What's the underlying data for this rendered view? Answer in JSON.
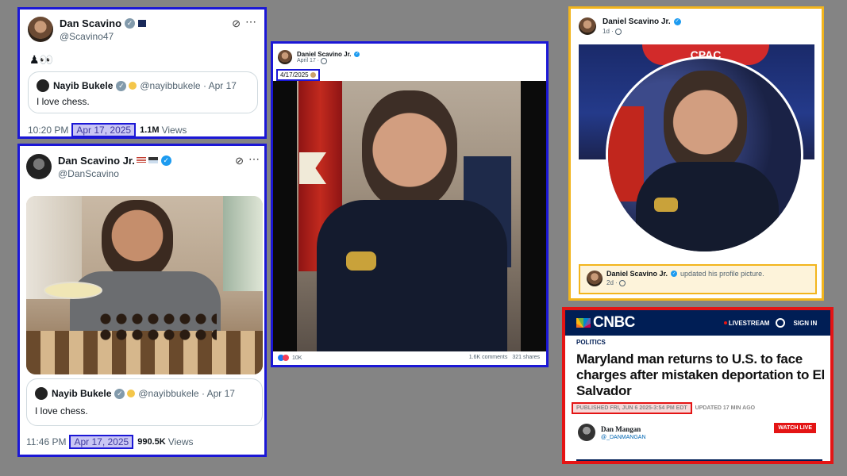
{
  "tweet1": {
    "name": "Dan Scavino",
    "handle": "@Scavino47",
    "body": "♟👀",
    "quote": {
      "name": "Nayib Bukele",
      "handle": "@nayibbukele · Apr 17",
      "text": "I love chess."
    },
    "time": "10:20 PM",
    "date": "Apr 17, 2025",
    "views_count": "1.1M",
    "views_label": "Views"
  },
  "tweet2": {
    "name": "Dan Scavino Jr.",
    "handle": "@DanScavino",
    "quote": {
      "name": "Nayib Bukele",
      "handle": "@nayibbukele · Apr 17",
      "text": "I love chess."
    },
    "time": "11:46 PM",
    "date": "Apr 17, 2025",
    "views_count": "990.5K",
    "views_label": "Views"
  },
  "fbpost": {
    "name": "Daniel Scavino Jr.",
    "date": "April 17 ·",
    "tag": "4/17/2025",
    "reactions": "10K",
    "comments": "1.6K comments",
    "shares": "321 shares"
  },
  "profile": {
    "name": "Daniel Scavino Jr.",
    "time": "1d ·",
    "banner_text": "CPAC",
    "update_name": "Daniel Scavino Jr.",
    "update_text": "updated his profile picture.",
    "update_time": "2d ·"
  },
  "cnbc": {
    "logo": "CNBC",
    "livestream": "LIVESTREAM",
    "signin": "SIGN IN",
    "section": "POLITICS",
    "headline": "Maryland man returns to U.S. to face charges after mistaken deportation to El Salvador",
    "published": "PUBLISHED FRI, JUN 6 2025-3:54 PM EDT",
    "updated": "UPDATED 17 MIN AGO",
    "author": "Dan Mangan",
    "author_handle": "@_DANMANGAN",
    "watch": "WATCH LIVE",
    "colors": {
      "navy": "#001e55",
      "red": "#e41414"
    }
  }
}
